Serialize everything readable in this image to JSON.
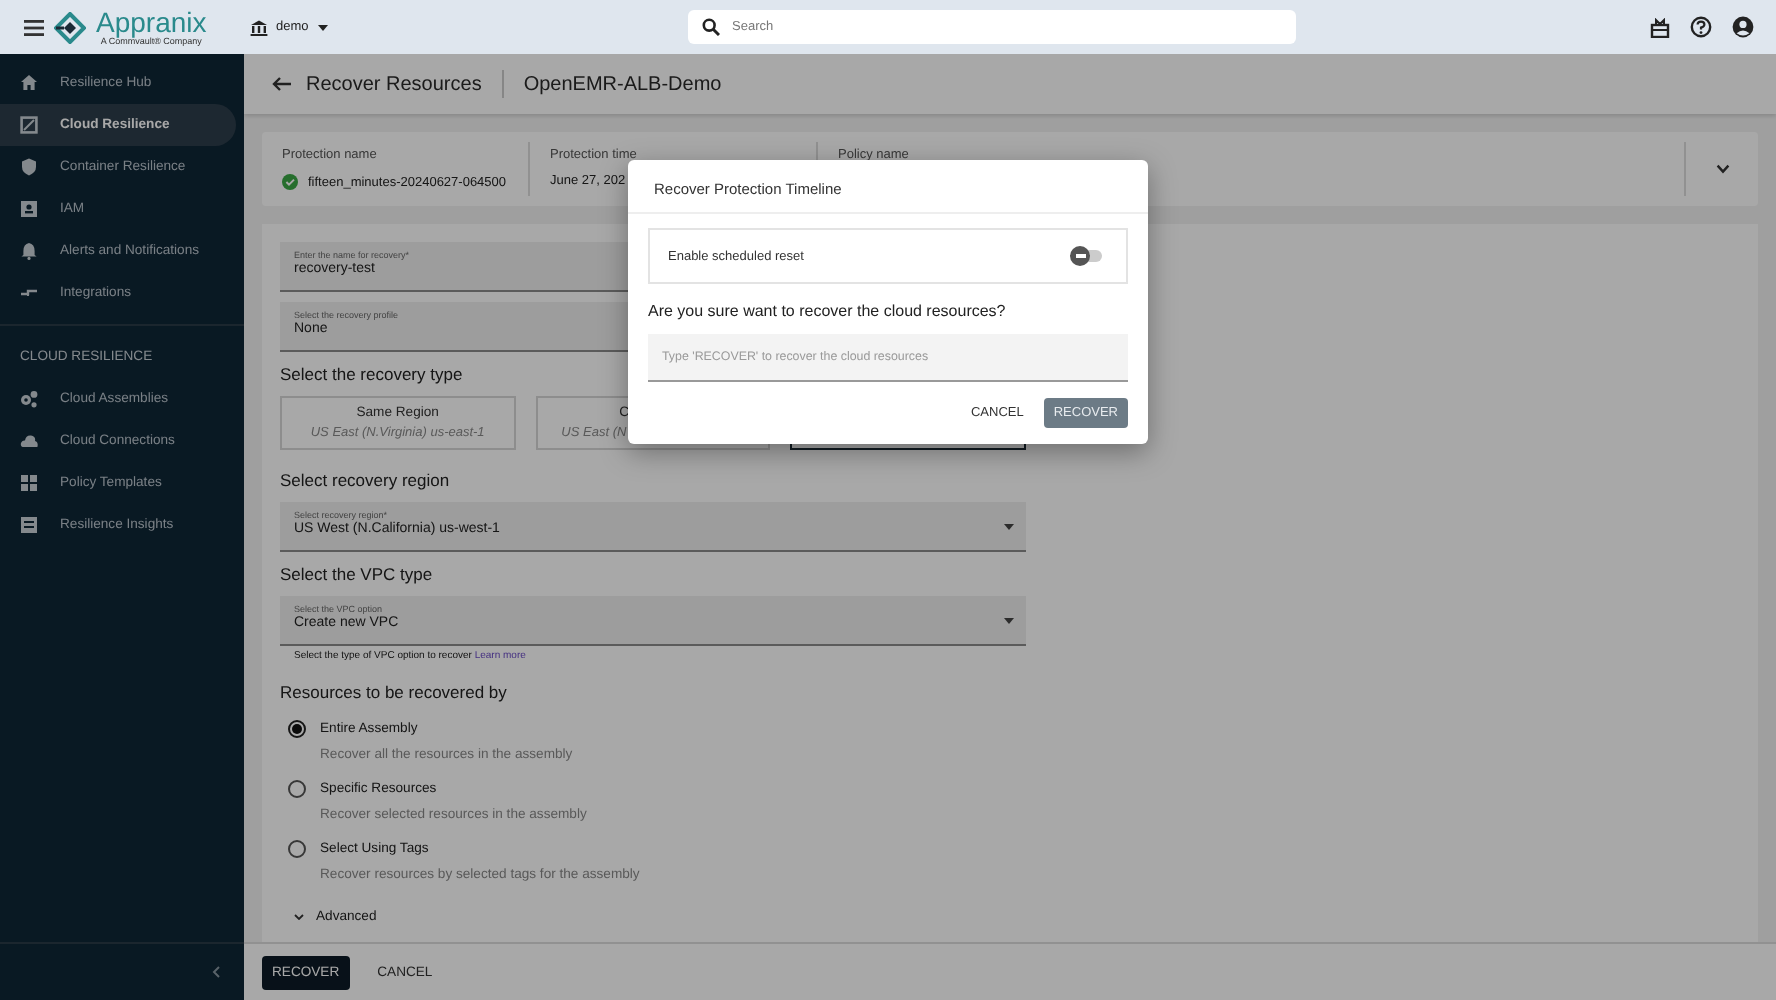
{
  "top_bar": {
    "brand": "Appranix",
    "brand_tagline": "A Commvault® Company",
    "tenant": "demo",
    "search": {
      "placeholder": "Search"
    }
  },
  "sidebar": {
    "items": [
      {
        "label": "Resilience Hub",
        "selected": false
      },
      {
        "label": "Cloud Resilience",
        "selected": true
      },
      {
        "label": "Container Resilience",
        "selected": false
      },
      {
        "label": "IAM",
        "selected": false
      },
      {
        "label": "Alerts and Notifications",
        "selected": false
      },
      {
        "label": "Integrations",
        "selected": false
      }
    ],
    "section_title": "CLOUD RESILIENCE",
    "section_items": [
      {
        "label": "Cloud Assemblies",
        "selected": false
      },
      {
        "label": "Cloud Connections",
        "selected": false
      },
      {
        "label": "Policy Templates",
        "selected": false
      },
      {
        "label": "Resilience Insights",
        "selected": false
      }
    ]
  },
  "page_header": {
    "title": "Recover Resources",
    "subtitle": "OpenEMR-ALB-Demo"
  },
  "summary": [
    {
      "label": "Protection name",
      "value": "fifteen_minutes-20240627-064500"
    },
    {
      "label": "Protection time",
      "value": "June 27, 202"
    },
    {
      "label": "Policy name"
    }
  ],
  "form": {
    "name_field": {
      "label": "Enter the name for recovery*",
      "value": "recovery-test"
    },
    "profile_field": {
      "label": "Select the recovery profile",
      "value": "None"
    },
    "recovery_type_heading": "Select the recovery type",
    "recovery_types": [
      {
        "title": "Same Region",
        "subtitle": "US East (N.Virginia) us-east-1",
        "selected": false
      },
      {
        "title": "C",
        "subtitle": "US East (N",
        "selected": false
      },
      {
        "selected": true
      }
    ],
    "region_heading": "Select recovery region",
    "region_select": {
      "label": "Select recovery region*",
      "value": "US West (N.California) us-west-1"
    },
    "vpc_heading": "Select the VPC type",
    "vpc_select": {
      "label": "Select the VPC option",
      "value": "Create new VPC",
      "helper": "Select the type of VPC option to recover",
      "helper_link": "Learn more"
    },
    "resources_heading": "Resources to be recovered by",
    "resource_options": [
      {
        "label": "Entire Assembly",
        "description": "Recover all the resources in the assembly",
        "selected": true
      },
      {
        "label": "Specific Resources",
        "description": "Recover selected resources in the assembly",
        "selected": false
      },
      {
        "label": "Select Using Tags",
        "description": "Recover resources by selected tags for the assembly",
        "selected": false
      }
    ],
    "advanced": {
      "label": "Advanced",
      "expanded": false
    }
  },
  "bottom_bar": {
    "buttons": [
      "RECOVER",
      "CANCEL"
    ]
  },
  "dialog": {
    "title": "Recover Protection Timeline",
    "reset_toggle": {
      "label": "Enable scheduled reset",
      "on": false
    },
    "question": "Are you sure want to recover the cloud resources?",
    "confirm_field": {
      "placeholder": "Type 'RECOVER' to recover the cloud resources"
    },
    "cancel": "CANCEL",
    "confirm": {
      "label": "RECOVER",
      "disabled": true
    }
  }
}
